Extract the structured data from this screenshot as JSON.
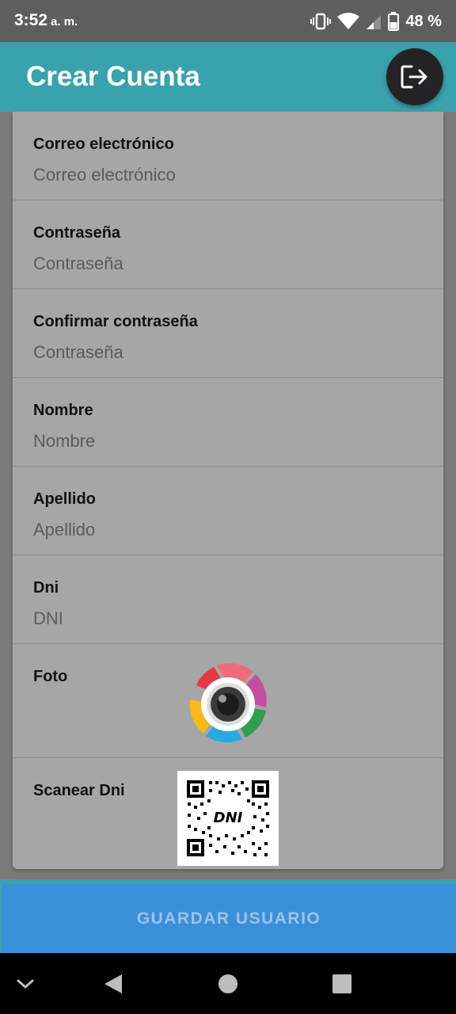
{
  "status_bar": {
    "time": "3:52",
    "ampm": "a. m.",
    "battery_percent": "48 %",
    "icons": [
      "vibrate-icon",
      "wifi-icon",
      "signal-icon",
      "battery-icon"
    ]
  },
  "app_bar": {
    "title": "Crear Cuenta",
    "color": "#3aa2ad",
    "logout_icon": "logout-icon"
  },
  "form": {
    "fields": [
      {
        "label": "Correo electrónico",
        "value": "",
        "placeholder": "Correo electrónico"
      },
      {
        "label": "Contraseña",
        "value": "",
        "placeholder": "Contraseña"
      },
      {
        "label": "Confirmar contraseña",
        "value": "",
        "placeholder": "Contraseña"
      },
      {
        "label": "Nombre",
        "value": "",
        "placeholder": "Nombre"
      },
      {
        "label": "Apellido",
        "value": "",
        "placeholder": "Apellido"
      },
      {
        "label": "Dni",
        "value": "",
        "placeholder": "DNI"
      }
    ],
    "photo": {
      "label": "Foto",
      "icon": "camera-shutter-icon"
    },
    "scan": {
      "label": "Scanear Dni",
      "icon": "qr-code-icon",
      "qr_text": "DNI"
    }
  },
  "save_button": {
    "label": "GUARDAR USUARIO",
    "color": "#3a90d8"
  },
  "nav_bar": {
    "icons": [
      "chevron-down-icon",
      "back-icon",
      "home-icon",
      "recents-icon"
    ]
  }
}
